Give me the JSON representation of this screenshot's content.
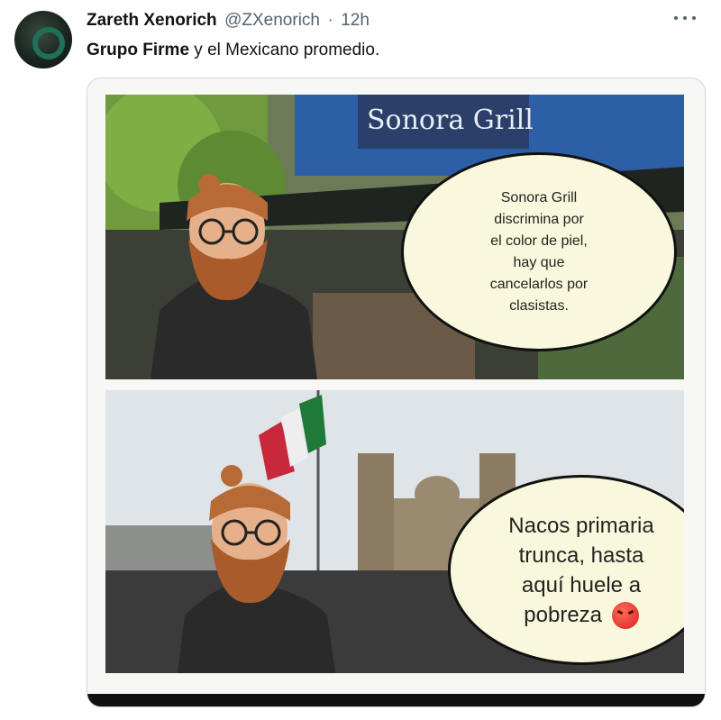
{
  "tweet": {
    "author_name": "Zareth Xenorich",
    "handle": "@ZXenorich",
    "separator": "·",
    "time": "12h",
    "text_bold": "Grupo Firme",
    "text_rest": " y el Mexicano promedio."
  },
  "meme": {
    "sign_text": "Sonora Grill",
    "panel1_bubble_lines": [
      "Sonora Grill",
      "discrimina por",
      "el color de piel,",
      "hay que",
      "cancelarlos por",
      "clasistas."
    ],
    "panel2_bubble_lines": [
      "Nacos primaria",
      "trunca, hasta",
      "aquí huele a",
      "pobreza"
    ],
    "emoji": "angry-face-icon"
  },
  "colors": {
    "name": "#0f1419",
    "secondary": "#536471",
    "bubble_fill": "#faf8dc",
    "flag_green": "#1f7a3a",
    "flag_red": "#c7283a"
  }
}
